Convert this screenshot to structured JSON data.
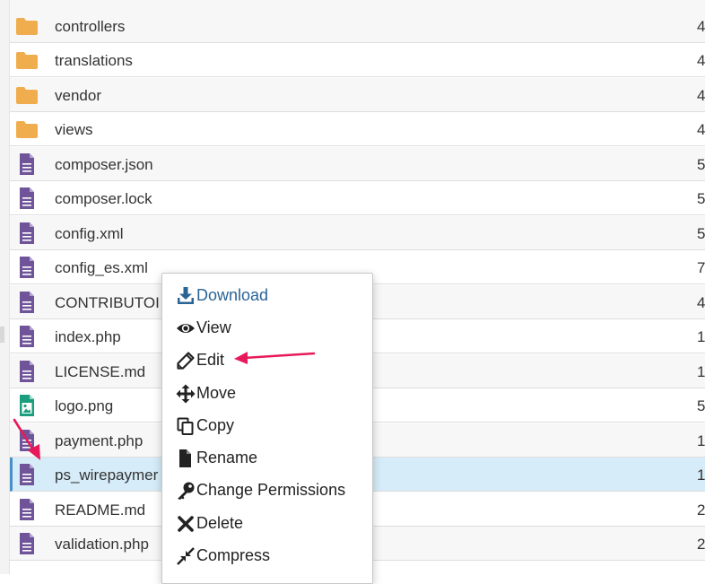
{
  "files": [
    {
      "name": "controllers",
      "type": "folder",
      "size": "4"
    },
    {
      "name": "translations",
      "type": "folder",
      "size": "4"
    },
    {
      "name": "vendor",
      "type": "folder",
      "size": "4"
    },
    {
      "name": "views",
      "type": "folder",
      "size": "4"
    },
    {
      "name": "composer.json",
      "type": "file",
      "size": "5"
    },
    {
      "name": "composer.lock",
      "type": "file",
      "size": "5"
    },
    {
      "name": "config.xml",
      "type": "file",
      "size": "5"
    },
    {
      "name": "config_es.xml",
      "type": "file",
      "size": "7"
    },
    {
      "name": "CONTRIBUTOI",
      "type": "file",
      "size": "4"
    },
    {
      "name": "index.php",
      "type": "file",
      "size": "1"
    },
    {
      "name": "LICENSE.md",
      "type": "file",
      "size": "1"
    },
    {
      "name": "logo.png",
      "type": "image",
      "size": "5"
    },
    {
      "name": "payment.php",
      "type": "file",
      "size": "1"
    },
    {
      "name": "ps_wirepaymer",
      "type": "file",
      "size": "1",
      "selected": true
    },
    {
      "name": "README.md",
      "type": "file",
      "size": "2"
    },
    {
      "name": "validation.php",
      "type": "file",
      "size": "2"
    }
  ],
  "context_menu": {
    "items": [
      {
        "label": "Download",
        "icon": "download-icon"
      },
      {
        "label": "View",
        "icon": "eye-icon"
      },
      {
        "label": "Edit",
        "icon": "pencil-icon"
      },
      {
        "label": "Move",
        "icon": "move-arrows-icon"
      },
      {
        "label": "Copy",
        "icon": "copy-icon"
      },
      {
        "label": "Rename",
        "icon": "file-icon"
      },
      {
        "label": "Change Permissions",
        "icon": "key-icon"
      },
      {
        "label": "Delete",
        "icon": "x-icon"
      },
      {
        "label": "Compress",
        "icon": "compress-icon"
      }
    ]
  },
  "colors": {
    "folder": "#f0ad4e",
    "file": "#6f5499",
    "image": "#1a9e7e",
    "selected_row": "#d6ecf8",
    "annotation_arrow": "#e8195a",
    "download_link": "#2a6496"
  }
}
